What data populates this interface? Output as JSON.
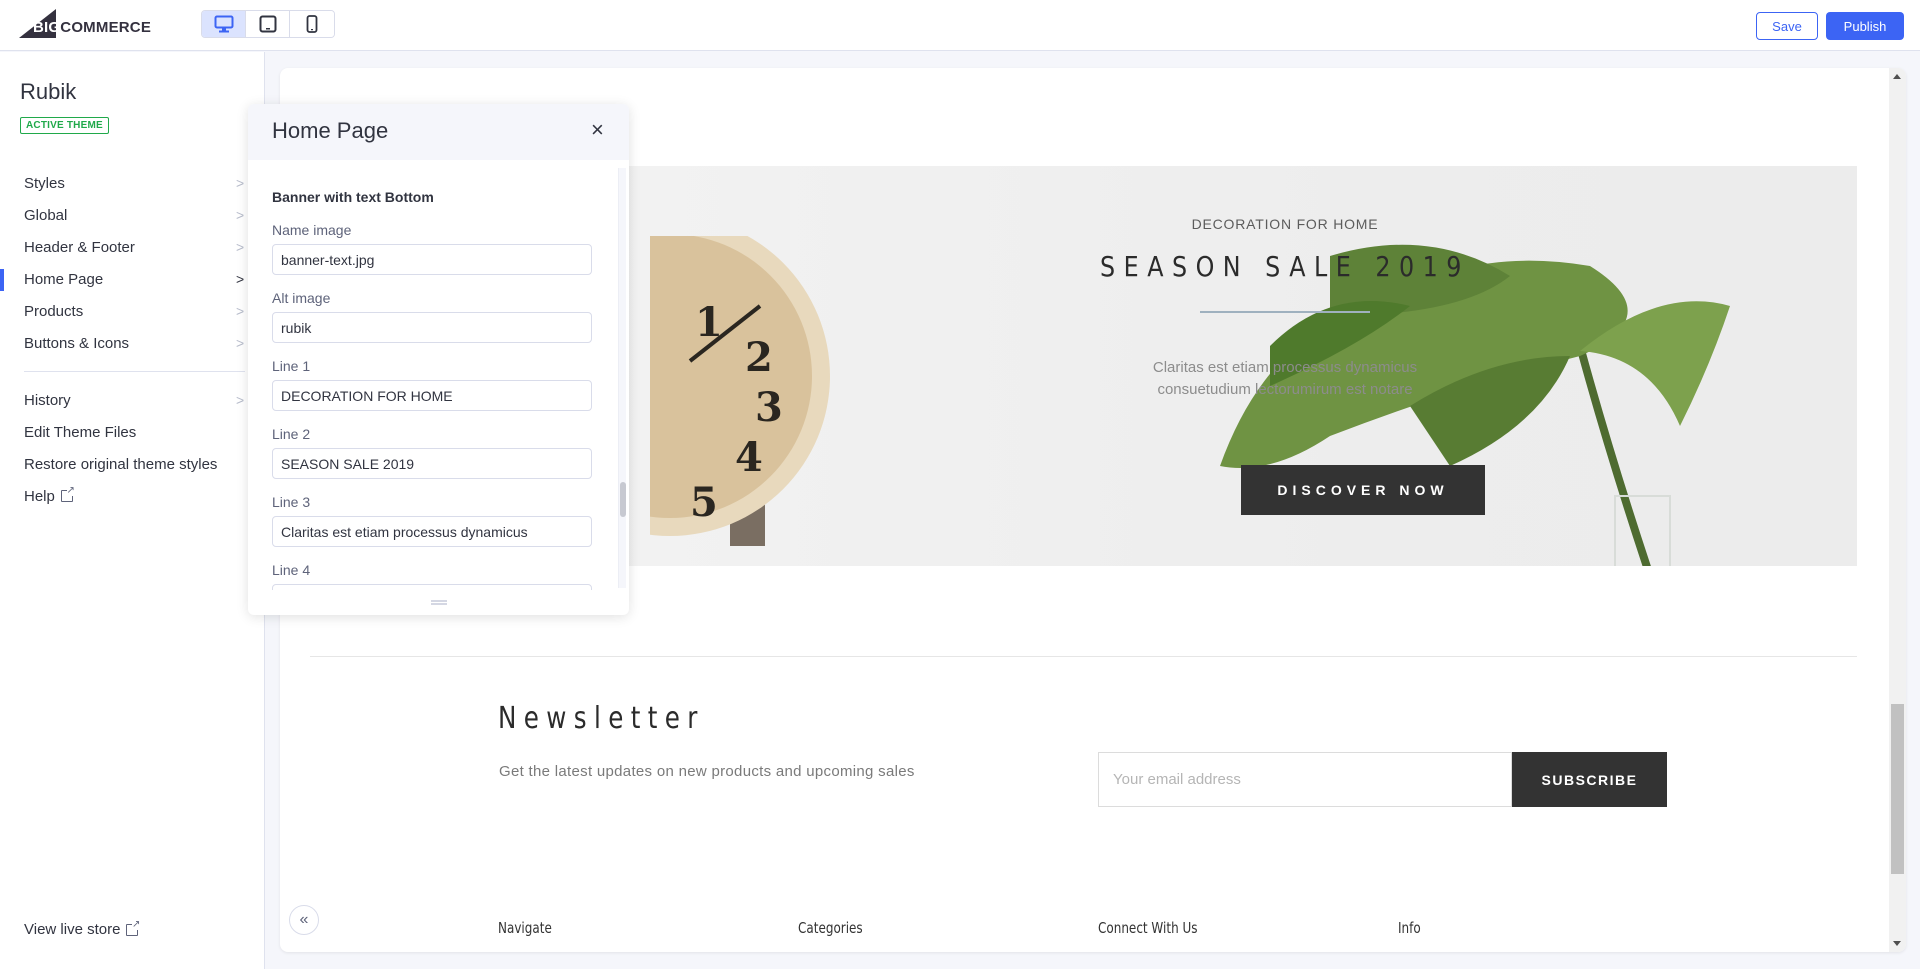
{
  "topbar": {
    "logo": {
      "big": "BIG",
      "rest": "COMMERCE"
    },
    "devices": [
      {
        "name": "desktop",
        "icon": "desktop-icon",
        "active": true
      },
      {
        "name": "tablet",
        "icon": "tablet-icon",
        "active": false
      },
      {
        "name": "mobile",
        "icon": "mobile-icon",
        "active": false
      }
    ],
    "save_label": "Save",
    "publish_label": "Publish"
  },
  "sidebar": {
    "theme_name": "Rubik",
    "badge": "ACTIVE THEME",
    "items": [
      {
        "label": "Styles",
        "chevron": true,
        "selected": false
      },
      {
        "label": "Global",
        "chevron": true,
        "selected": false
      },
      {
        "label": "Header & Footer",
        "chevron": true,
        "selected": false
      },
      {
        "label": "Home Page",
        "chevron": true,
        "selected": true
      },
      {
        "label": "Products",
        "chevron": true,
        "selected": false
      },
      {
        "label": "Buttons & Icons",
        "chevron": true,
        "selected": false
      }
    ],
    "secondary_items": [
      {
        "label": "History",
        "chevron": true
      },
      {
        "label": "Edit Theme Files",
        "chevron": false
      },
      {
        "label": "Restore original theme styles",
        "chevron": false
      },
      {
        "label": "Help",
        "external": true
      }
    ],
    "view_live_store": "View live store"
  },
  "panel": {
    "title": "Home Page",
    "close_icon": "×",
    "section_title": "Banner with text Bottom",
    "fields": [
      {
        "label": "Name image",
        "value": "banner-text.jpg"
      },
      {
        "label": "Alt image",
        "value": "rubik"
      },
      {
        "label": "Line 1",
        "value": "DECORATION FOR HOME"
      },
      {
        "label": "Line 2",
        "value": "SEASON SALE 2019"
      },
      {
        "label": "Line 3",
        "value": "Claritas est etiam processus dynamicus"
      },
      {
        "label": "Line 4",
        "value": ""
      }
    ]
  },
  "preview": {
    "banner": {
      "line1": "DECORATION FOR HOME",
      "line2": "SEASON SALE 2019",
      "line3a": "Claritas est etiam processus dynamicus",
      "line3b": "consuetudium lectorumirum est notare",
      "button": "DISCOVER NOW"
    },
    "newsletter": {
      "title": "Newsletter",
      "subtitle": "Get the latest updates on new products and upcoming sales",
      "email_placeholder": "Your email address",
      "subscribe": "SUBSCRIBE"
    },
    "footer_columns": [
      "Navigate",
      "Categories",
      "Connect With Us",
      "Info"
    ],
    "collapse_icon": "«"
  },
  "colors": {
    "accent": "#3c64f4",
    "active_badge": "#20a94a",
    "dark_button": "#333333"
  }
}
